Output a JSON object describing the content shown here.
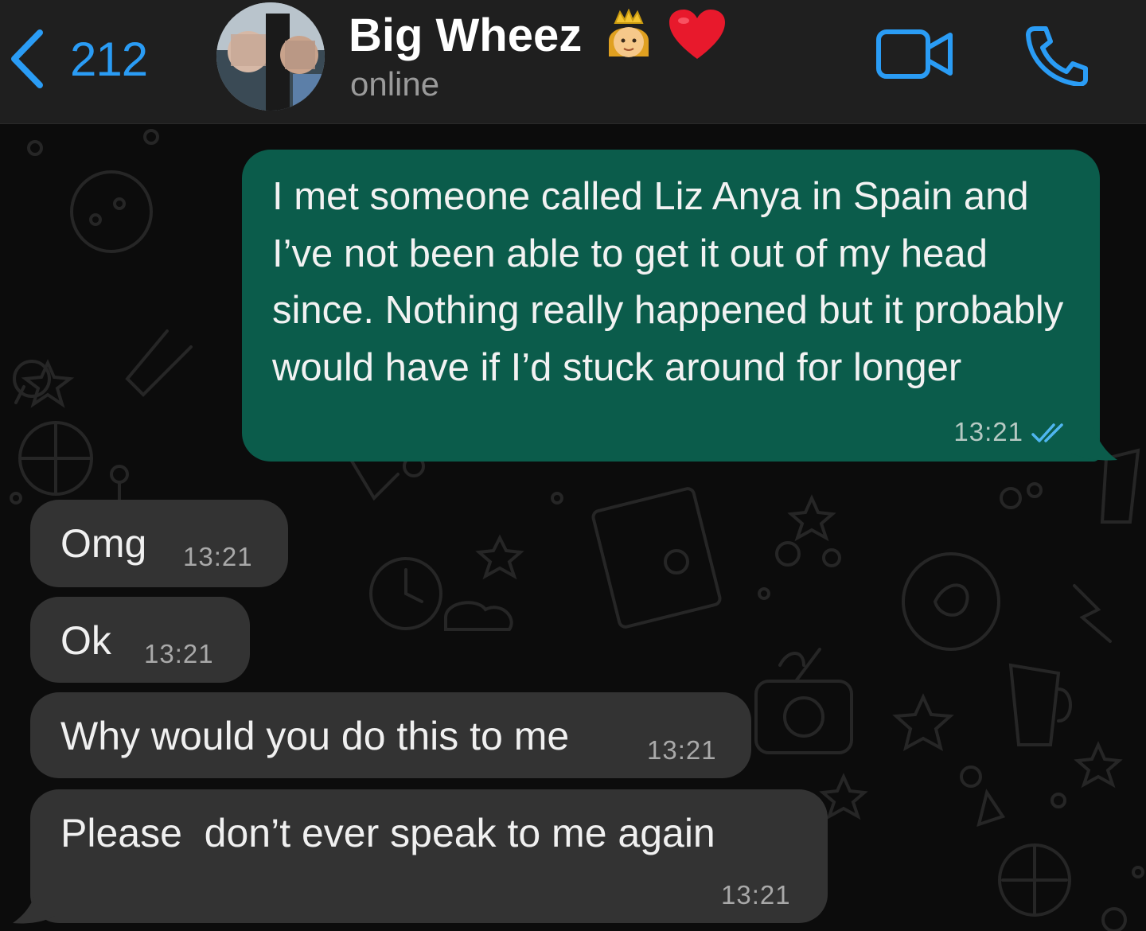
{
  "header": {
    "back_count": "212",
    "contact_name": "Big Wheez",
    "status": "online",
    "back_icon": "chevron-left-icon",
    "video_icon": "video-call-icon",
    "phone_icon": "phone-icon",
    "name_emojis": [
      "princess-emoji",
      "red-heart-emoji"
    ],
    "accent_color": "#2a9cf5"
  },
  "messages": [
    {
      "direction": "outgoing",
      "text": "I met someone called Liz Anya in Spain and I’ve not been able to get it out of my head since. Nothing really happened but it probably would have if I’d stuck around for longer",
      "time": "13:21",
      "read": true
    },
    {
      "direction": "incoming",
      "text": "Omg",
      "time": "13:21"
    },
    {
      "direction": "incoming",
      "text": "Ok",
      "time": "13:21"
    },
    {
      "direction": "incoming",
      "text": "Why would you do this to me",
      "time": "13:21"
    },
    {
      "direction": "incoming",
      "text": "Please  don’t ever speak to me again",
      "time": "13:21"
    }
  ],
  "colors": {
    "outgoing_bubble": "#0b5c4b",
    "incoming_bubble": "#333333",
    "read_ticks": "#4fb6f0"
  }
}
